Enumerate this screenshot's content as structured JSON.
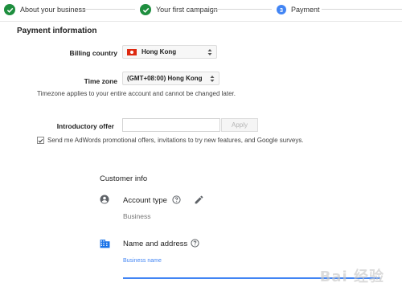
{
  "stepper": {
    "steps": [
      {
        "label": "About your business",
        "state": "done"
      },
      {
        "label": "Your first campaign",
        "state": "done"
      },
      {
        "label": "Payment",
        "state": "current",
        "number": "3"
      }
    ]
  },
  "payment": {
    "title": "Payment information",
    "billing_country_label": "Billing country",
    "billing_country_value": "Hong Kong",
    "timezone_label": "Time zone",
    "timezone_value": "(GMT+08:00) Hong Kong",
    "timezone_note": "Timezone applies to your entire account and cannot be changed later.",
    "intro_offer_label": "Introductory offer",
    "intro_offer_value": "",
    "apply_label": "Apply",
    "promo_checkbox_label": "Send me AdWords promotional offers, invitations to try new features, and Google surveys.",
    "promo_checked": true
  },
  "customer_info": {
    "title": "Customer info",
    "account_type_label": "Account type",
    "account_type_value": "Business",
    "name_address_label": "Name and address",
    "business_name_label": "Business name"
  },
  "watermark": "Bai 经验",
  "colors": {
    "accent": "#4285f4",
    "success": "#1e8e3e",
    "flag_red": "#de2910"
  }
}
